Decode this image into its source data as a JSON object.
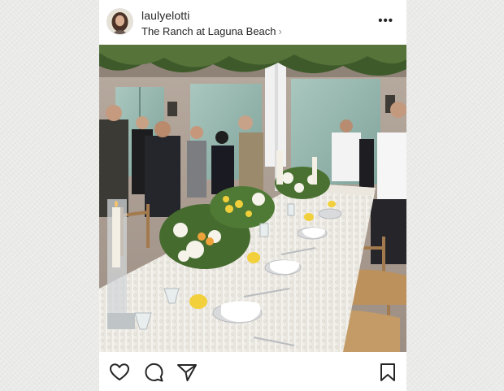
{
  "post": {
    "username": "laulyelotti",
    "location": "The Ranch at Laguna Beach",
    "location_chevron": "›",
    "more_label": "•••"
  },
  "photo": {
    "subject": "Outdoor wedding reception table with white lace tablecloth, lemon and orange floral centerpieces, candles, and guests mingling in a courtyard"
  },
  "actions": {
    "icons": [
      "heart-icon",
      "comment-icon",
      "share-icon",
      "bookmark-icon"
    ]
  },
  "colors": {
    "text": "#262626",
    "secondary": "#8e8e8e",
    "card": "#ffffff",
    "backdrop": "#eeeeec"
  }
}
